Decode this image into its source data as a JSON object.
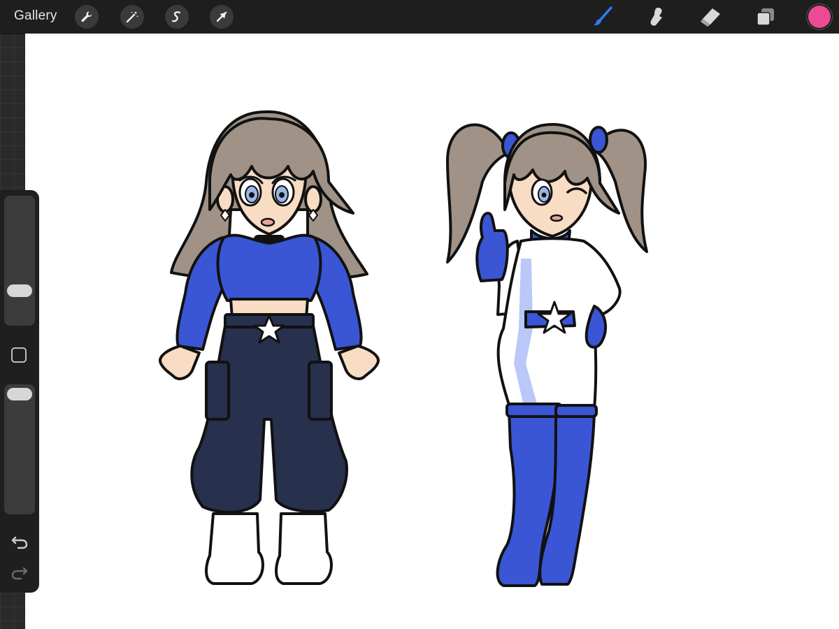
{
  "topbar": {
    "gallery_label": "Gallery",
    "left_tools": [
      "wrench-icon",
      "magic-wand-icon",
      "selection-icon",
      "transform-arrow-icon"
    ],
    "right_tools": [
      "brush-icon",
      "smudge-icon",
      "eraser-icon",
      "layers-icon"
    ],
    "active_tool": "brush-icon",
    "accent_color": "#2f7bf5",
    "current_color": "#ec4a93"
  },
  "sidebar": {
    "controls": [
      "brush-size-slider",
      "modify-button",
      "opacity-slider",
      "undo-icon",
      "redo-icon"
    ]
  },
  "canvas": {
    "artwork": "two-character-drawing",
    "palette": {
      "hair": "#a09286",
      "skin": "#f8dcc4",
      "blue": "#3a56d4",
      "light_blue": "#b9c8f6",
      "navy": "#27304d",
      "white": "#ffffff"
    }
  }
}
